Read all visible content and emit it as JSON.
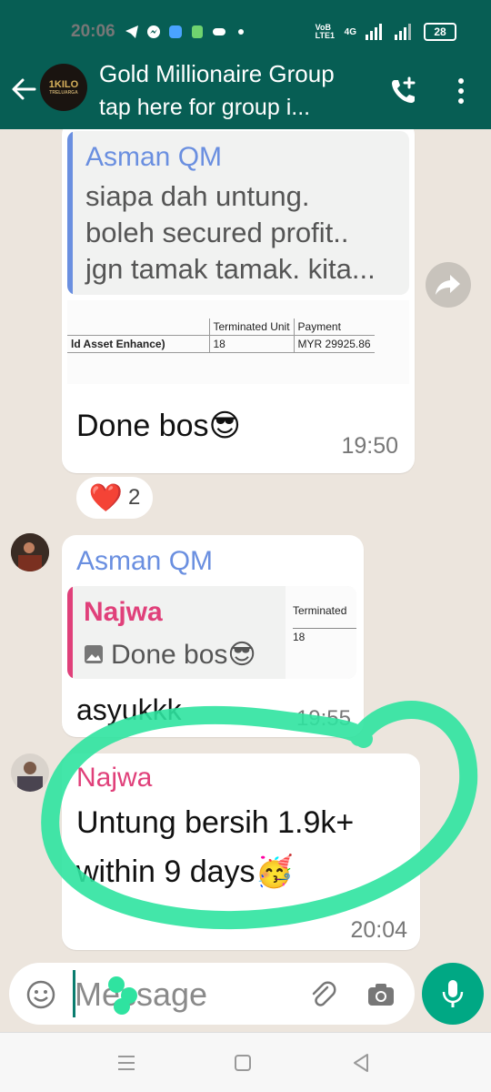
{
  "statusbar": {
    "time": "20:06",
    "network_label": "VoB LTE1",
    "signal_label": "4G",
    "battery": "28"
  },
  "header": {
    "title": "Gold Millionaire Group",
    "subtitle": "tap here for group i...",
    "avatar_text": "1KILO",
    "avatar_sub": "TRELUARGA"
  },
  "messages": {
    "m1": {
      "quote_sender": "Asman QM",
      "quote_lines": [
        "siapa dah untung.",
        "boleh secured profit..",
        "jgn tamak tamak. kita..."
      ],
      "snippet": {
        "col1_header": "Terminated Unit",
        "col2_header": "Payment",
        "row_label": "ld Asset Enhance)",
        "unit": "18",
        "payment": "MYR 29925.86"
      },
      "text": "Done bos😎",
      "time": "19:50",
      "reaction_emoji": "❤️",
      "reaction_count": "2"
    },
    "m2": {
      "sender": "Asman QM",
      "quote_sender": "Najwa",
      "quote_text": "Done bos😎",
      "snippet_header": "Terminated",
      "snippet_value": "18",
      "text": "asyukkk",
      "time": "19:55"
    },
    "m3": {
      "sender": "Najwa",
      "text_line1": "Untung bersih 1.9k+",
      "text_line2": "within 9 days🥳",
      "time": "20:04"
    }
  },
  "input": {
    "placeholder": "Message"
  },
  "colors": {
    "header_bg": "#075e54",
    "chat_bg": "#ece5dd",
    "asman_name": "#6a8fe0",
    "najwa_name": "#e0407a",
    "accent_green": "#00a884",
    "scribble_green": "#2fe3a0"
  }
}
